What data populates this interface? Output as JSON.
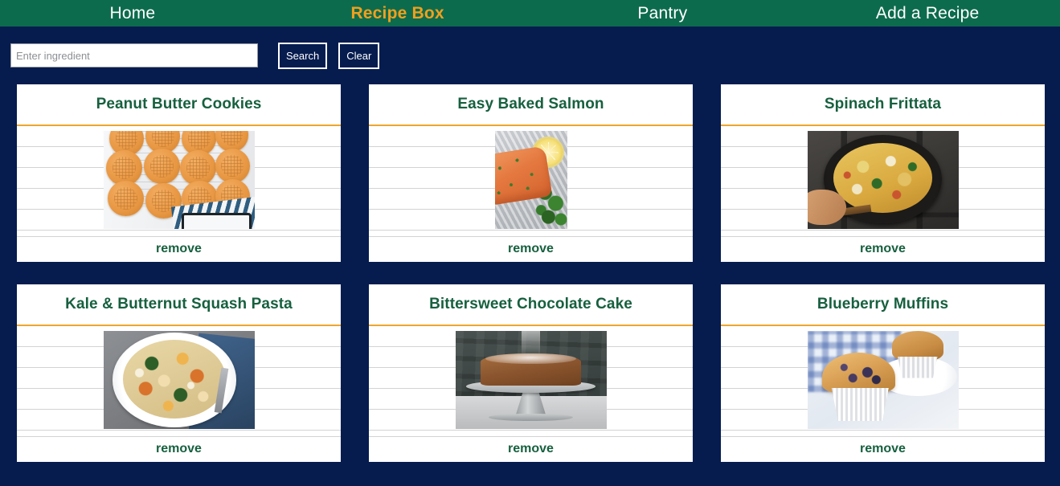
{
  "nav": {
    "items": [
      {
        "label": "Home",
        "active": false
      },
      {
        "label": "Recipe Box",
        "active": true
      },
      {
        "label": "Pantry",
        "active": false
      },
      {
        "label": "Add a Recipe",
        "active": false
      }
    ]
  },
  "search": {
    "placeholder": "Enter ingredient",
    "value": "",
    "search_label": "Search",
    "clear_label": "Clear"
  },
  "colors": {
    "nav_bg": "#0d6b4d",
    "page_bg": "#061c4f",
    "accent_orange": "#eda52d",
    "active_nav": "#f0a01e",
    "title_green": "#17603f",
    "card_bg": "#ffffff",
    "rule_gray": "#d3d3d3"
  },
  "recipes": [
    {
      "title": "Peanut Butter Cookies",
      "remove_label": "remove",
      "photo": "peanut-butter-cookies-photo"
    },
    {
      "title": "Easy Baked Salmon",
      "remove_label": "remove",
      "photo": "easy-baked-salmon-photo"
    },
    {
      "title": "Spinach Frittata",
      "remove_label": "remove",
      "photo": "spinach-frittata-photo"
    },
    {
      "title": "Kale & Butternut Squash Pasta",
      "remove_label": "remove",
      "photo": "kale-butternut-squash-pasta-photo"
    },
    {
      "title": "Bittersweet Chocolate Cake",
      "remove_label": "remove",
      "photo": "bittersweet-chocolate-cake-photo"
    },
    {
      "title": "Blueberry Muffins",
      "remove_label": "remove",
      "photo": "blueberry-muffins-photo"
    }
  ]
}
